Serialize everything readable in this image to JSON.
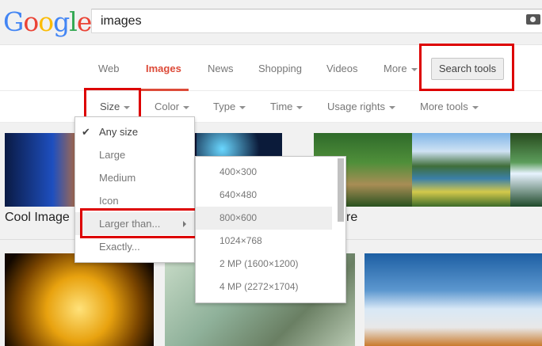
{
  "header": {
    "logo_text": "Google",
    "logo_colors": [
      "#4285f4",
      "#ea4335",
      "#fbbc05",
      "#4285f4",
      "#34a853",
      "#ea4335"
    ],
    "search_value": "images",
    "camera_icon": "camera-icon"
  },
  "nav": {
    "tabs": [
      {
        "label": "Web"
      },
      {
        "label": "Images"
      },
      {
        "label": "News"
      },
      {
        "label": "Shopping"
      },
      {
        "label": "Videos"
      },
      {
        "label": "More"
      }
    ],
    "active_color": "#dd4b39",
    "search_tools_label": "Search tools"
  },
  "tools": {
    "items": [
      {
        "label": "Size"
      },
      {
        "label": "Color"
      },
      {
        "label": "Type"
      },
      {
        "label": "Time"
      },
      {
        "label": "Usage rights"
      },
      {
        "label": "More tools"
      }
    ]
  },
  "size_menu": {
    "items": [
      {
        "label": "Any size",
        "checked": true
      },
      {
        "label": "Large"
      },
      {
        "label": "Medium"
      },
      {
        "label": "Icon"
      },
      {
        "label": "Larger than...",
        "has_submenu": true
      },
      {
        "label": "Exactly..."
      }
    ]
  },
  "larger_than_menu": {
    "items": [
      {
        "label": "400×300"
      },
      {
        "label": "640×480"
      },
      {
        "label": "800×600",
        "highlighted": true
      },
      {
        "label": "1024×768"
      },
      {
        "label": "2 MP (1600×1200)"
      },
      {
        "label": "4 MP (2272×1704)"
      }
    ]
  },
  "results": {
    "caption_left": "Cool Image",
    "caption_right": "re"
  },
  "highlight_color": "#dd0000"
}
